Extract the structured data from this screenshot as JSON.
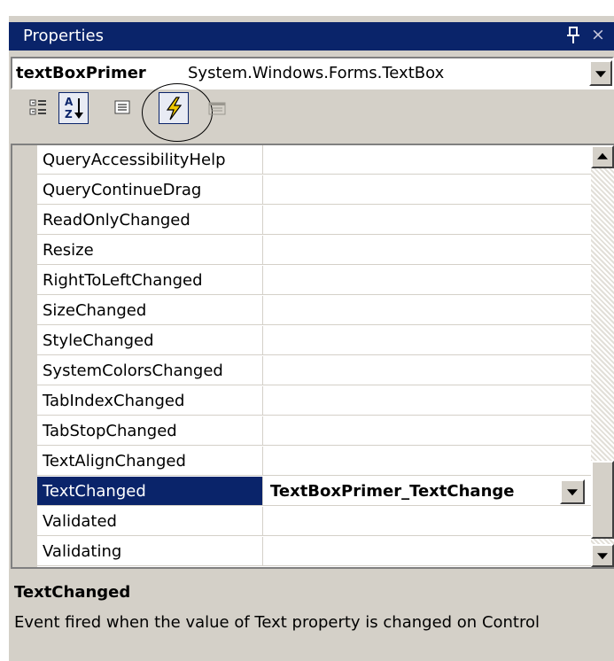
{
  "window": {
    "title": "Properties",
    "close_glyph": "×"
  },
  "object_selector": {
    "name": "textBoxPrimer",
    "type": "System.Windows.Forms.TextBox"
  },
  "toolbar": {
    "buttons": [
      {
        "icon": "categorized-icon"
      },
      {
        "icon": "alphabetical-icon",
        "label": "A Z"
      },
      {
        "icon": "properties-icon"
      },
      {
        "icon": "events-icon"
      },
      {
        "icon": "property-pages-icon"
      }
    ]
  },
  "grid": {
    "rows": [
      {
        "name": "QueryAccessibilityHelp",
        "value": ""
      },
      {
        "name": "QueryContinueDrag",
        "value": ""
      },
      {
        "name": "ReadOnlyChanged",
        "value": ""
      },
      {
        "name": "Resize",
        "value": ""
      },
      {
        "name": "RightToLeftChanged",
        "value": ""
      },
      {
        "name": "SizeChanged",
        "value": ""
      },
      {
        "name": "StyleChanged",
        "value": ""
      },
      {
        "name": "SystemColorsChanged",
        "value": ""
      },
      {
        "name": "TabIndexChanged",
        "value": ""
      },
      {
        "name": "TabStopChanged",
        "value": ""
      },
      {
        "name": "TextAlignChanged",
        "value": ""
      },
      {
        "name": "TextChanged",
        "value": "TextBoxPrimer_TextChange"
      },
      {
        "name": "Validated",
        "value": ""
      },
      {
        "name": "Validating",
        "value": ""
      }
    ]
  },
  "description": {
    "title": "TextChanged",
    "text": "Event fired when the value of Text property is changed on Control"
  },
  "colors": {
    "selection": "#0a246a",
    "face": "#d4d0c8"
  }
}
